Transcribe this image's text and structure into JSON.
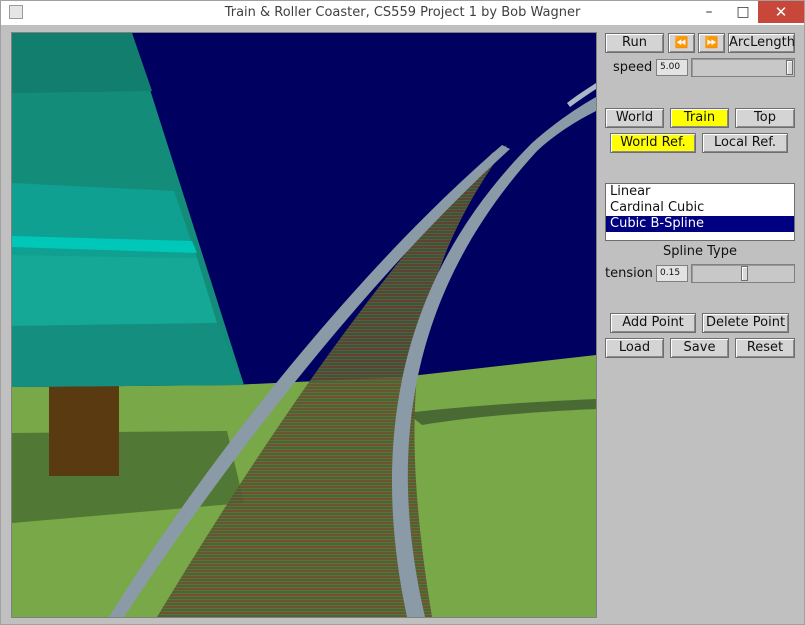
{
  "window": {
    "title": "Train & Roller Coaster, CS559 Project 1 by Bob Wagner",
    "minimize": "–",
    "maximize": "□",
    "close": "✕"
  },
  "controls": {
    "run": "Run",
    "step_back_icon": "⏪",
    "step_forward_icon": "⏩",
    "arclength": "ArcLength",
    "speed_label": "speed",
    "speed_value": "5.00",
    "speed_fraction": 1.0,
    "view_buttons": [
      {
        "label": "World",
        "active": false
      },
      {
        "label": "Train",
        "active": true
      },
      {
        "label": "Top",
        "active": false
      }
    ],
    "ref_buttons": [
      {
        "label": "World Ref.",
        "active": true
      },
      {
        "label": "Local Ref.",
        "active": false
      }
    ],
    "spline_options": [
      {
        "label": "Linear",
        "selected": false
      },
      {
        "label": "Cardinal Cubic",
        "selected": false
      },
      {
        "label": "Cubic B-Spline",
        "selected": true
      }
    ],
    "spline_type_label": "Spline Type",
    "tension_label": "tension",
    "tension_value": "0.15",
    "tension_fraction": 0.52,
    "add_point": "Add Point",
    "delete_point": "Delete Point",
    "load": "Load",
    "save": "Save",
    "reset": "Reset"
  },
  "colors": {
    "sky": "#000060",
    "ground": "#78a848",
    "tree_foliage": "#148c7a",
    "tree_highlight": "#00b8a8",
    "trunk": "#5a3a10",
    "rail": "#8a9aa6",
    "active_button": "#ffff00",
    "list_selection": "#000080"
  }
}
